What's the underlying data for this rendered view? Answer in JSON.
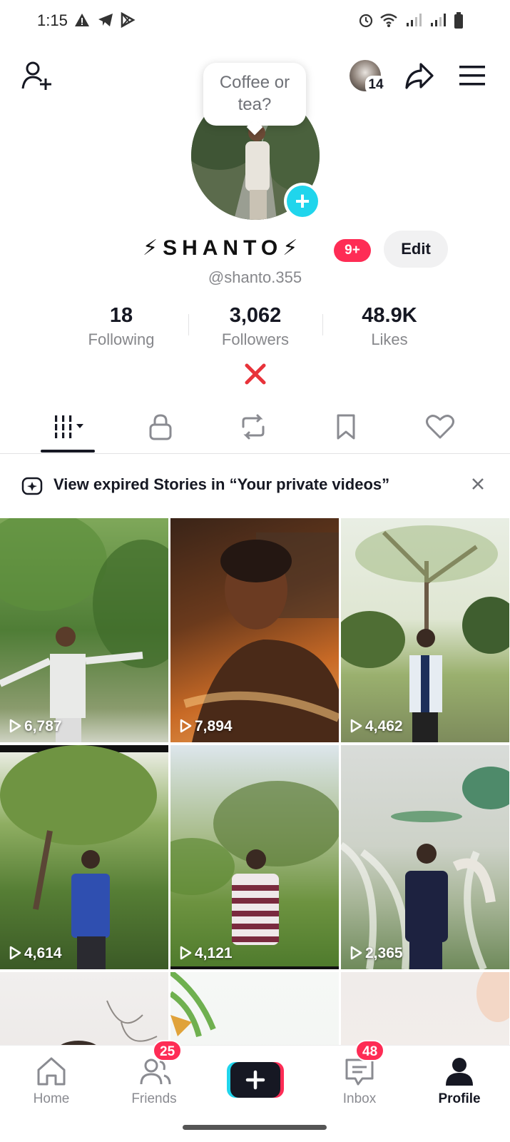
{
  "status_bar": {
    "time": "1:15"
  },
  "header": {
    "friends_count_badge": "14",
    "bubble_text": "Coffee or tea?"
  },
  "profile": {
    "display_name": "⚡SHANTO⚡",
    "notification_pill": "9+",
    "edit_label": "Edit",
    "handle": "@shanto.355",
    "stats": [
      {
        "value": "18",
        "label": "Following"
      },
      {
        "value": "3,062",
        "label": "Followers"
      },
      {
        "value": "48.9K",
        "label": "Likes"
      }
    ]
  },
  "banner": {
    "text": "View expired Stories in “Your private videos”"
  },
  "videos": [
    {
      "views": "6,787"
    },
    {
      "views": "7,894"
    },
    {
      "views": "4,462"
    },
    {
      "views": "4,614"
    },
    {
      "views": "4,121"
    },
    {
      "views": "2,365"
    }
  ],
  "bottom_nav": {
    "home": "Home",
    "friends": "Friends",
    "friends_badge": "25",
    "inbox": "Inbox",
    "inbox_badge": "48",
    "profile": "Profile"
  },
  "colors": {
    "accent": "#fe2c55",
    "cyan": "#20d5ec",
    "text": "#161823",
    "muted": "#86878b"
  }
}
